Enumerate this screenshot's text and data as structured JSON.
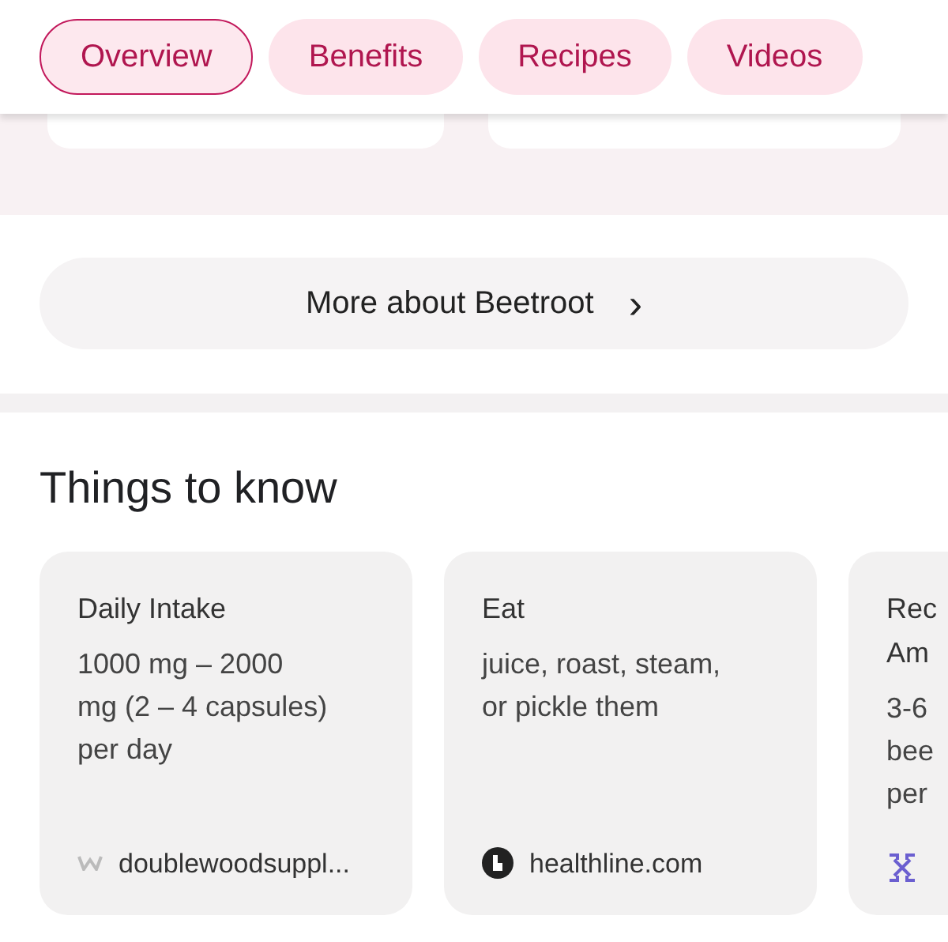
{
  "tabs": [
    {
      "label": "Overview",
      "selected": true
    },
    {
      "label": "Benefits",
      "selected": false
    },
    {
      "label": "Recipes",
      "selected": false
    },
    {
      "label": "Videos",
      "selected": false
    }
  ],
  "more_button": {
    "label": "More about Beetroot",
    "chevron": "›"
  },
  "section": {
    "title": "Things to know"
  },
  "cards": [
    {
      "title": "Daily Intake",
      "body": "1000 mg – 2000\nmg (2 – 4 capsules)\nper day",
      "source": "doublewoodsuppl...",
      "kind": "w"
    },
    {
      "title": "Eat",
      "body": "juice, roast, steam,\nor pickle them",
      "source": "healthline.com",
      "kind": "circle"
    },
    {
      "title": "Rec\nAm",
      "body": "3-6\nbee\nper",
      "kind": "cross"
    }
  ]
}
